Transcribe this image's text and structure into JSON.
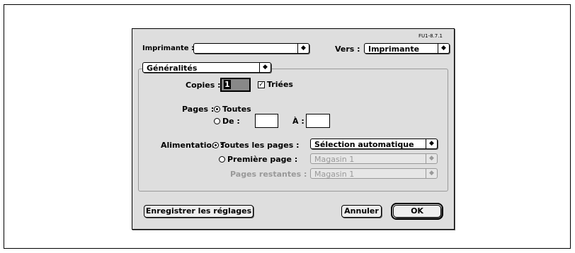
{
  "dialog": {
    "version": "FU1-8.7.1",
    "printer_label": "Imprimante :",
    "printer_value": "",
    "to_label": "Vers :",
    "to_value": "Imprimante",
    "section_value": "Généralités"
  },
  "copies": {
    "label": "Copies :",
    "value": "1",
    "collate_label": "Triées",
    "collate_checked": true
  },
  "pages": {
    "label": "Pages :",
    "all_label": "Toutes",
    "from_label": "De :",
    "to_label": "À :",
    "from_value": "",
    "to_value": ""
  },
  "paper": {
    "label": "Alimentation :",
    "all_pages_label": "Toutes les pages :",
    "all_pages_value": "Sélection automatique",
    "first_page_label": "Première page :",
    "first_page_value": "Magasin 1",
    "remaining_label": "Pages restantes :",
    "remaining_value": "Magasin 1"
  },
  "buttons": {
    "save": "Enregistrer les réglages",
    "cancel": "Annuler",
    "ok": "OK"
  },
  "icons": {
    "popup_arrows": "updown-arrows-icon"
  }
}
